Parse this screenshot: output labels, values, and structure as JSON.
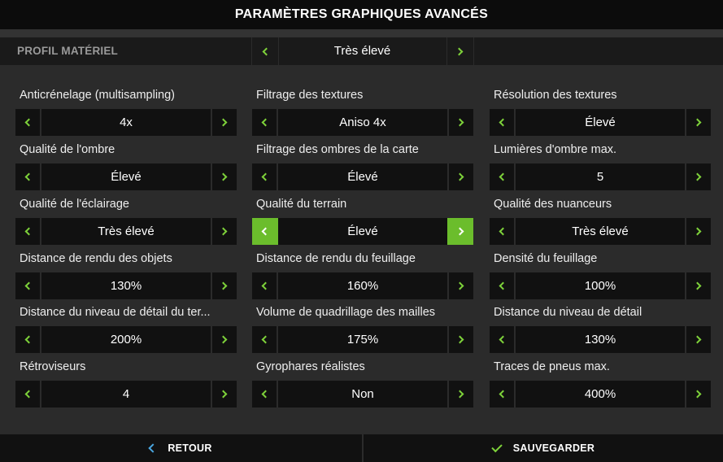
{
  "title": "PARAMÈTRES GRAPHIQUES AVANCÉS",
  "profile": {
    "label": "PROFIL MATÉRIEL",
    "value": "Très élevé"
  },
  "settings": [
    {
      "label": "Anticrénelage (multisampling)",
      "value": "4x"
    },
    {
      "label": "Filtrage des textures",
      "value": "Aniso 4x"
    },
    {
      "label": "Résolution des textures",
      "value": "Élevé"
    },
    {
      "label": "Qualité de l'ombre",
      "value": "Élevé"
    },
    {
      "label": "Filtrage des ombres de la carte",
      "value": "Élevé"
    },
    {
      "label": "Lumières d'ombre max.",
      "value": "5"
    },
    {
      "label": "Qualité de l'éclairage",
      "value": "Très élevé"
    },
    {
      "label": "Qualité du terrain",
      "value": "Élevé"
    },
    {
      "label": "Qualité des nuanceurs",
      "value": "Très élevé"
    },
    {
      "label": "Distance de rendu des objets",
      "value": "130%"
    },
    {
      "label": "Distance de rendu du feuillage",
      "value": "160%"
    },
    {
      "label": "Densité du feuillage",
      "value": "100%"
    },
    {
      "label": "Distance du niveau de détail du ter...",
      "value": "200%"
    },
    {
      "label": "Volume de quadrillage des mailles",
      "value": "175%"
    },
    {
      "label": "Distance du niveau de détail",
      "value": "130%"
    },
    {
      "label": "Rétroviseurs",
      "value": "4"
    },
    {
      "label": "Gyrophares réalistes",
      "value": "Non"
    },
    {
      "label": "Traces de pneus max.",
      "value": "400%"
    }
  ],
  "active_setting_index": 7,
  "footer": {
    "back_label": "RETOUR",
    "save_label": "SAUVEGARDER"
  },
  "colors": {
    "accent_green": "#6bbd2c",
    "back_blue": "#4aa6e0"
  },
  "icons": {
    "prev": "chevron-left-icon",
    "next": "chevron-right-icon",
    "back": "back-arrow-icon",
    "save": "checkmark-icon"
  }
}
